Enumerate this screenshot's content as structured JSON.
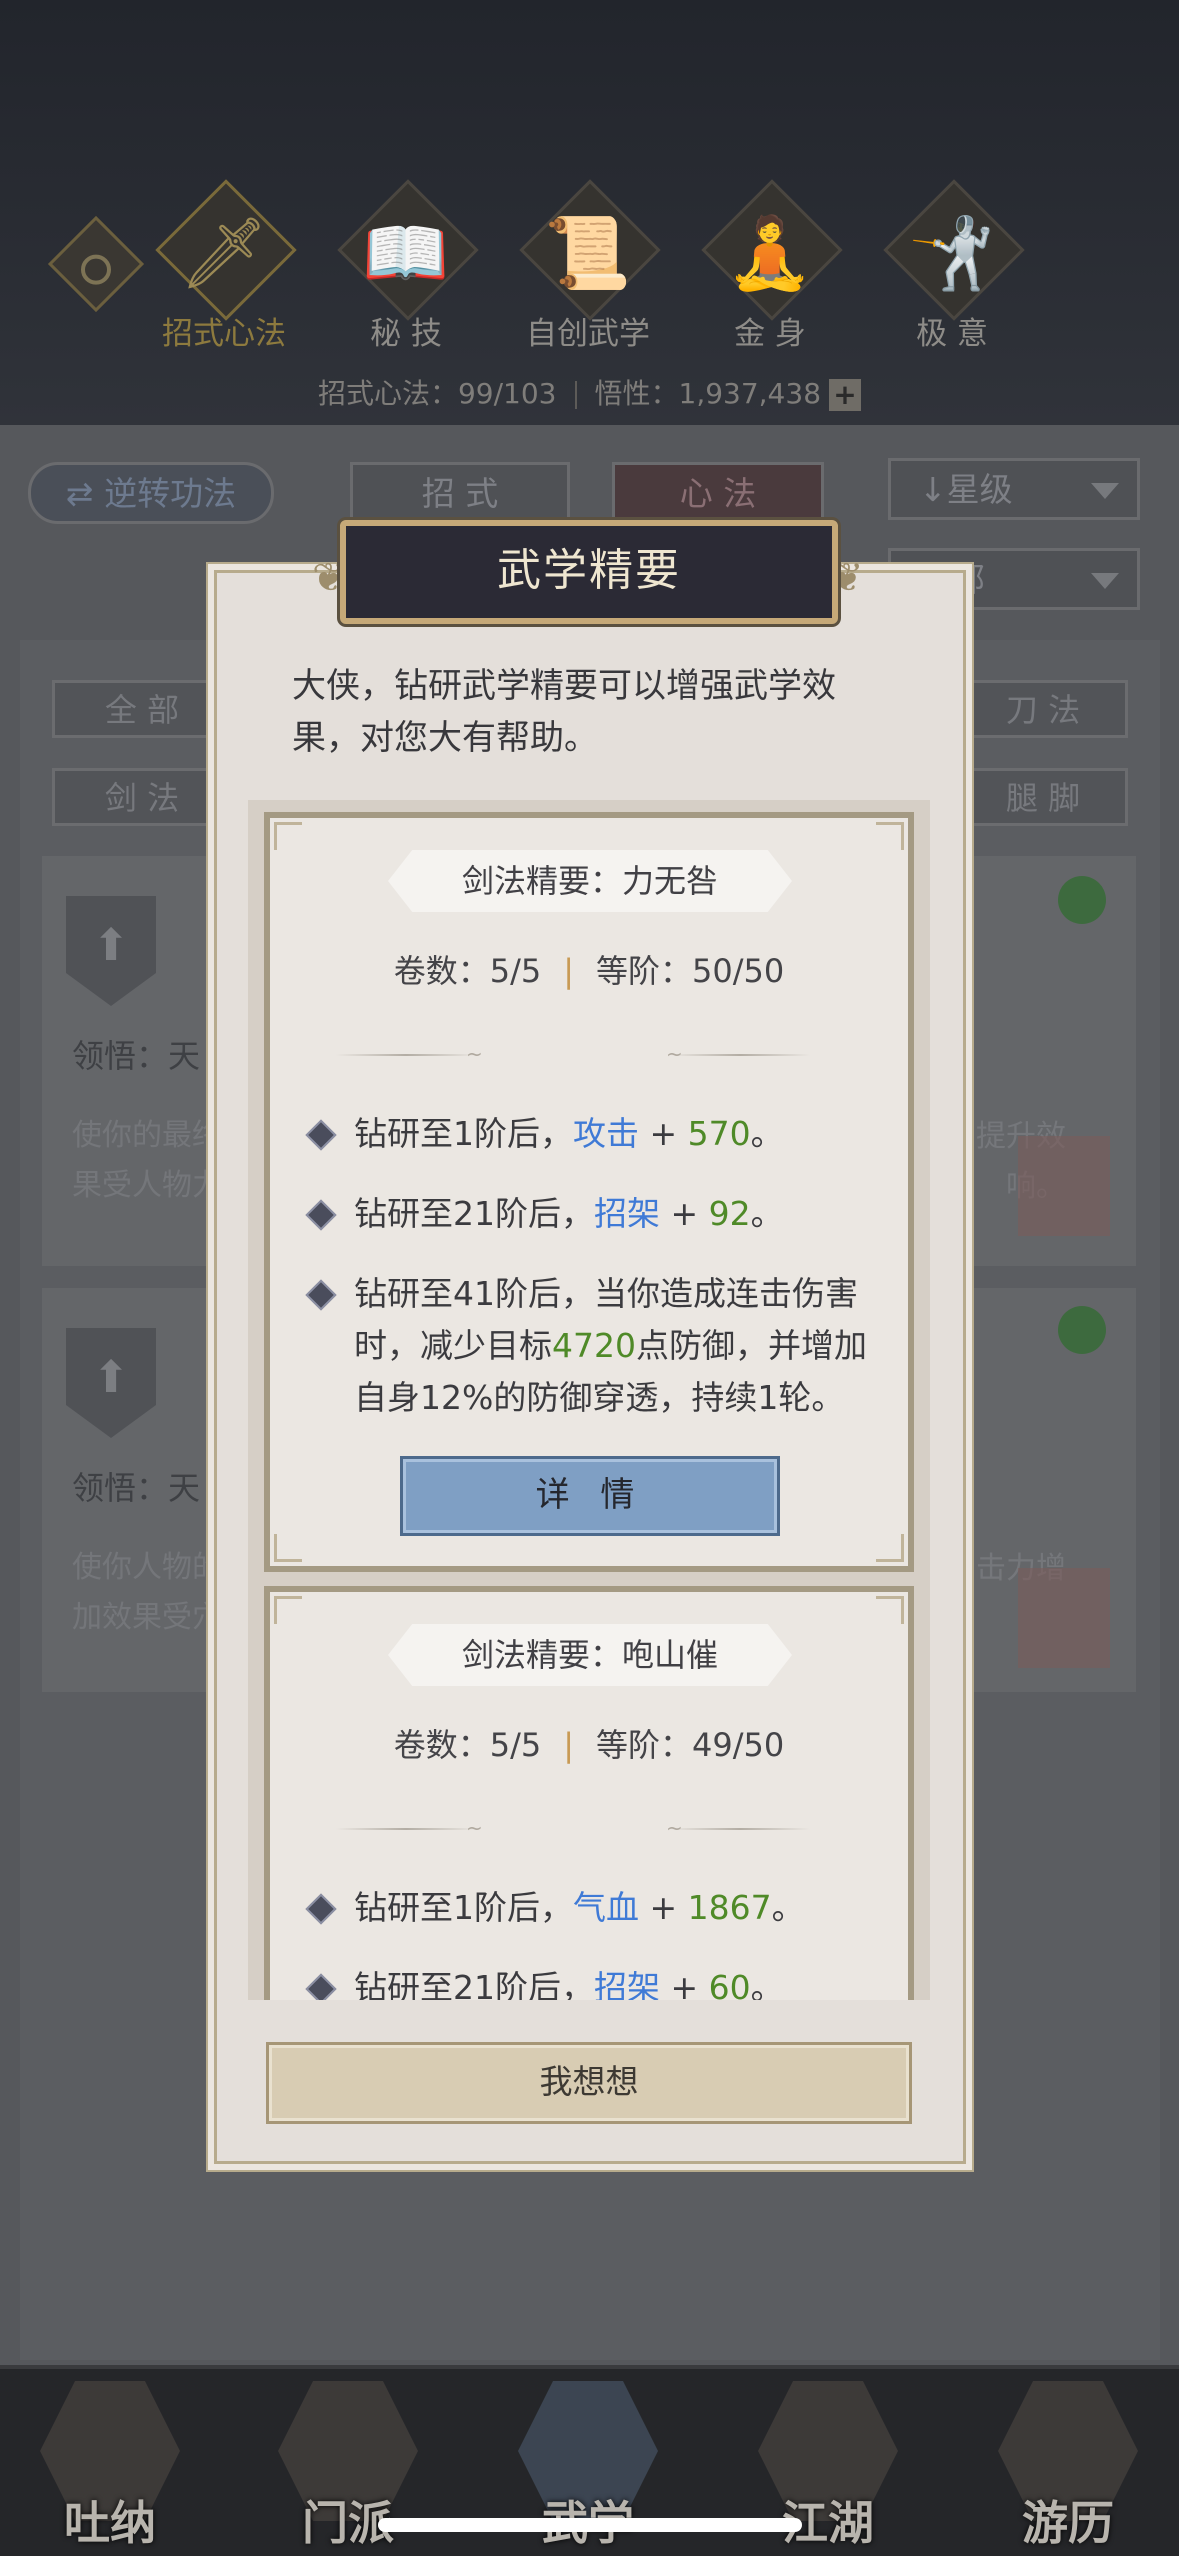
{
  "categories": [
    {
      "label": "招式心法",
      "icon": "sword-icon",
      "active": true
    },
    {
      "label": "秘 技",
      "icon": "book-icon",
      "active": false
    },
    {
      "label": "自创武学",
      "icon": "scroll-icon",
      "active": false
    },
    {
      "label": "金 身",
      "icon": "meditation-icon",
      "active": false
    },
    {
      "label": "极 意",
      "icon": "martial-pose-icon",
      "active": false
    }
  ],
  "stats": {
    "moves_label": "招式心法：99/103",
    "insight_label": "悟性：1,937,438"
  },
  "toolbar": {
    "reverse_label": "逆转功法",
    "tab_moves": "招 式",
    "tab_mind": "心 法",
    "sort_label": "星级",
    "filter_label": "全部"
  },
  "filters": {
    "all": "全 部",
    "blade": "刀 法",
    "sword": "剑 法",
    "leg": "腿 脚"
  },
  "cards": [
    {
      "ling": "领悟：天",
      "desc_left": "使你的最终",
      "desc_left2": "果受人物力",
      "desc_right": "提升效",
      "desc_right2": "响。"
    },
    {
      "ling": "领悟：天",
      "desc_left": "使你人物的",
      "desc_left2": "加效果受穴",
      "desc_right": "击力增",
      "desc_right2": ""
    }
  ],
  "modal": {
    "title": "武学精要",
    "intro": "大侠，钻研武学精要可以增强武学效果，对您大有帮助。",
    "entries": [
      {
        "name": "剑法精要：力无咎",
        "volumes": "卷数：5/5",
        "rank": "等阶：50/50",
        "effects": [
          {
            "prefix": "钻研至1阶后，",
            "keyword": "攻击",
            "plus": " + ",
            "value": "570",
            "suffix": "。"
          },
          {
            "prefix": "钻研至21阶后，",
            "keyword": "招架",
            "plus": " + ",
            "value": "92",
            "suffix": "。"
          },
          {
            "prefix": "钻研至41阶后，当你造成连击伤害时，减少目标",
            "keyword": "",
            "plus": "",
            "value": "4720",
            "suffix": "点防御，并增加自身12%的防御穿透，持续1轮。"
          }
        ],
        "detail_label": "详 情"
      },
      {
        "name": "剑法精要：咆山催",
        "volumes": "卷数：5/5",
        "rank": "等阶：49/50",
        "effects": [
          {
            "prefix": "钻研至1阶后，",
            "keyword": "气血",
            "plus": " + ",
            "value": "1867",
            "suffix": "。"
          },
          {
            "prefix": "钻研至21阶后，",
            "keyword": "招架",
            "plus": " + ",
            "value": "60",
            "suffix": "。"
          }
        ]
      }
    ],
    "confirm_label": "我想想"
  },
  "bottom_nav": [
    {
      "label": "吐纳",
      "active": false
    },
    {
      "label": "门派",
      "active": false
    },
    {
      "label": "武学",
      "active": true
    },
    {
      "label": "江湖",
      "active": false
    },
    {
      "label": "游历",
      "active": false
    }
  ]
}
